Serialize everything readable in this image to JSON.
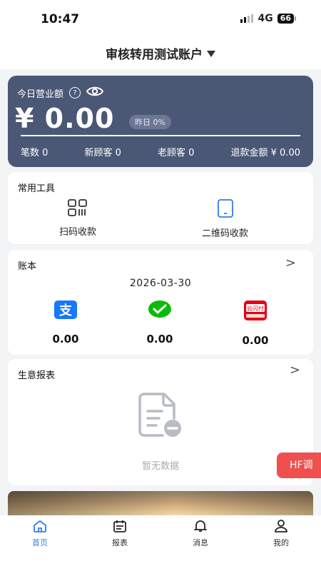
{
  "status_bar": {
    "time": "10:47",
    "network": "4G",
    "battery": "66"
  },
  "header": {
    "title": "审核转用测试账户"
  },
  "revenue": {
    "label": "今日营业额",
    "amount": "¥ 0.00",
    "yesterday": "昨日 0%",
    "stats": [
      "笔数 0",
      "新顾客 0",
      "老顾客 0",
      "退款金额 ¥ 0.00"
    ]
  },
  "tools": {
    "title": "常用工具",
    "items": [
      {
        "label": "扫码收款",
        "icon": "qr-scan-icon"
      },
      {
        "label": "二维码收款",
        "icon": "tablet-icon"
      }
    ]
  },
  "ledger": {
    "title": "账本",
    "date": "2026-03-30",
    "channels": [
      {
        "icon": "alipay-icon",
        "value": "0.00",
        "color": "#1677ff"
      },
      {
        "icon": "wechat-pay-icon",
        "value": "0.00",
        "color": "#09bb07"
      },
      {
        "icon": "unionpay-cloud-icon",
        "value": "0.00",
        "color": "#e60012"
      }
    ]
  },
  "report": {
    "title": "生意报表",
    "empty_text": "暂无数据"
  },
  "floating": {
    "label": "HF调"
  },
  "tabbar": {
    "items": [
      {
        "label": "首页",
        "icon": "home-icon",
        "active": true
      },
      {
        "label": "报表",
        "icon": "calendar-icon",
        "active": false
      },
      {
        "label": "消息",
        "icon": "bell-icon",
        "active": false
      },
      {
        "label": "我的",
        "icon": "person-icon",
        "active": false
      }
    ],
    "active_color": "#2f7ee8"
  },
  "colors": {
    "card": "#4a5775",
    "background": "#f3f4f6",
    "accent_red": "#ef4f4f"
  }
}
